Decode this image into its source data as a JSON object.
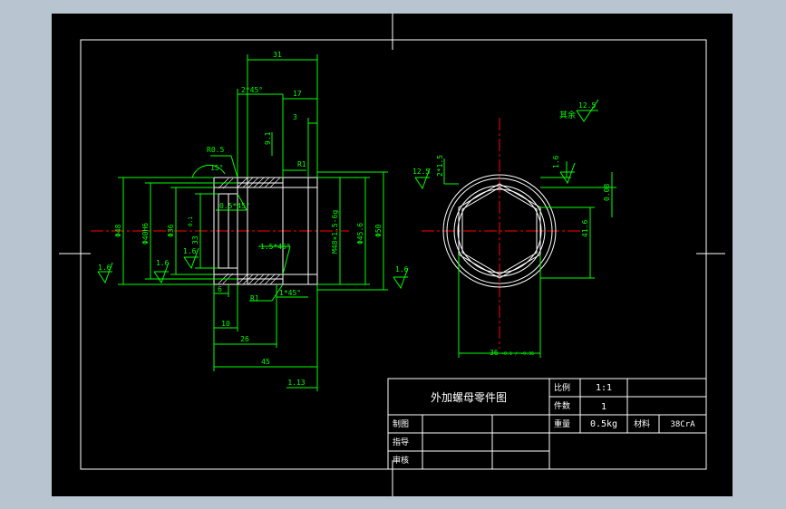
{
  "colors": {
    "background": "#000000",
    "frame": "#ffffff",
    "geometry": "#ffffff",
    "dimension": "#00ff00",
    "centerline": "#ff0000",
    "outer_bg": "#b8c4d0"
  },
  "dims_top": {
    "d31": "31",
    "d2x45": "2*45°",
    "d17": "17",
    "d3": "3",
    "d91": "9.1",
    "r05": "R0.5",
    "a15": "15°",
    "r1a": "R1"
  },
  "dims_left": {
    "phi48": "Φ48",
    "phi40": "Φ40H6",
    "phi36": "Φ36",
    "phi33": "33",
    "phi0_1": "0.1",
    "r16a": "1.6",
    "r16b": "1.6",
    "r16c": "1.6",
    "ch05": "0.5*45°",
    "ch15": "1.5*45°"
  },
  "dims_right_section": {
    "m48": "M48×1.5-6g",
    "phi456": "Φ45.6",
    "phi50": "Φ50",
    "r16": "1.6"
  },
  "dims_bottom": {
    "d6": "6",
    "r1b": "R1",
    "c1": "1*45°",
    "d10": "10",
    "d26": "26",
    "d45": "45",
    "d113": "1.13"
  },
  "end_view": {
    "r125a": "12.5",
    "c15": "2*1.5",
    "r16": "1.6",
    "r125b": "12.5",
    "rest_label": "其余",
    "d416": "41.6",
    "t008": "0.08",
    "d36": "36",
    "tol": "-0.1 / -0.36"
  },
  "title_block": {
    "title": "外加螺母零件图",
    "scale_label": "比例",
    "scale_value": "1:1",
    "count_label": "件数",
    "count_value": "1",
    "draw_label": "制图",
    "weight_label": "重量",
    "weight_value": "0.5kg",
    "material_label": "材料",
    "material_value": "38CrA",
    "check_label": "指导",
    "review_label": "审核"
  }
}
